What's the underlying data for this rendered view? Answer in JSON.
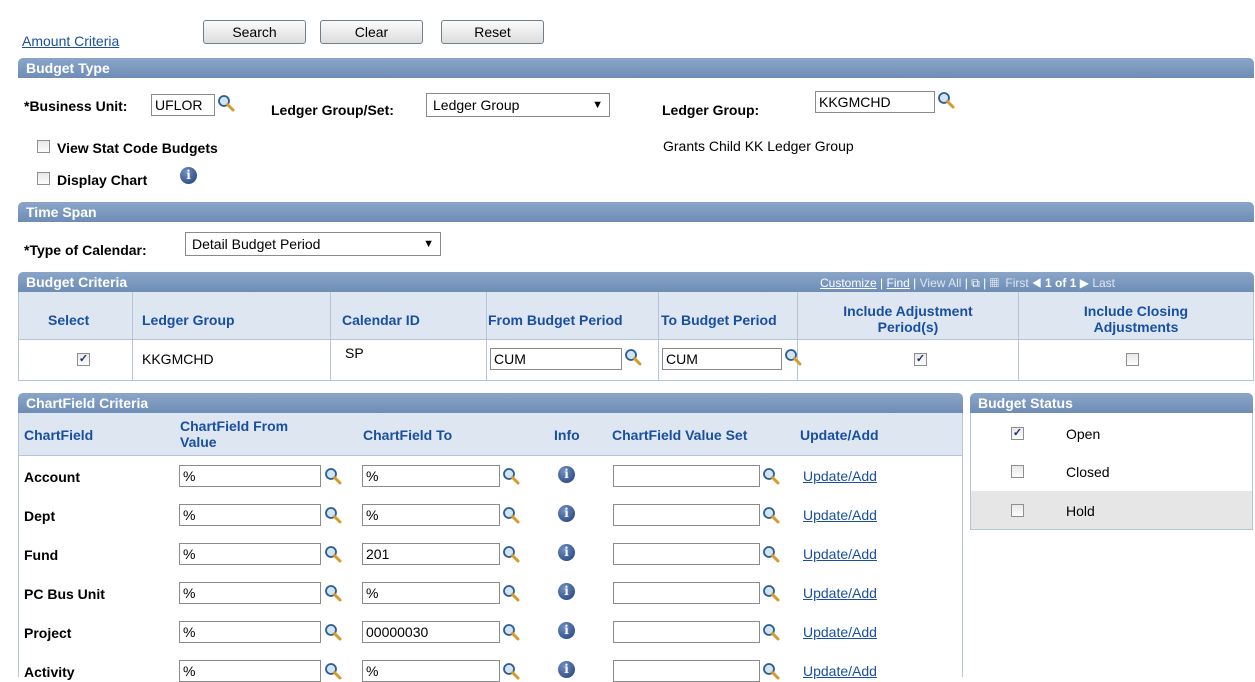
{
  "links": {
    "amount_criteria": "Amount Criteria"
  },
  "buttons": {
    "search": "Search",
    "clear": "Clear",
    "reset": "Reset"
  },
  "budget_type": {
    "header": "Budget Type",
    "business_unit_label": "*Business Unit:",
    "business_unit_value": "UFLOR",
    "ledger_group_set_label": "Ledger Group/Set:",
    "ledger_group_set_value": "Ledger Group",
    "ledger_group_label": "Ledger Group:",
    "ledger_group_value": "KKGMCHD",
    "ledger_group_desc": "Grants Child KK Ledger Group",
    "view_stat_code_label": "View Stat Code Budgets",
    "view_stat_code_checked": false,
    "display_chart_label": "Display Chart",
    "display_chart_checked": false
  },
  "time_span": {
    "header": "Time Span",
    "type_of_calendar_label": "*Type of Calendar:",
    "type_of_calendar_value": "Detail Budget Period"
  },
  "budget_criteria": {
    "header": "Budget Criteria",
    "nav": {
      "customize": "Customize",
      "find": "Find",
      "view_all": "View All",
      "first": "First",
      "count": "1 of 1",
      "last": "Last"
    },
    "columns": {
      "select": "Select",
      "ledger_group": "Ledger Group",
      "calendar_id": "Calendar ID",
      "from_period": "From Budget Period",
      "to_period": "To Budget Period",
      "incl_adj": "Include Adjustment Period(s)",
      "incl_closing": "Include Closing Adjustments"
    },
    "row": {
      "select": true,
      "ledger_group": "KKGMCHD",
      "calendar_id": "SP",
      "from_period": "CUM",
      "to_period": "CUM",
      "incl_adj": true,
      "incl_closing": false
    }
  },
  "chartfield_criteria": {
    "header": "ChartField Criteria",
    "columns": {
      "chartfield": "ChartField",
      "from_value": "ChartField From Value",
      "to": "ChartField To",
      "info": "Info",
      "value_set": "ChartField Value Set",
      "update_add": "Update/Add"
    },
    "rows": [
      {
        "name": "Account",
        "from": "%",
        "to": "%",
        "value_set": "",
        "link": "Update/Add"
      },
      {
        "name": "Dept",
        "from": "%",
        "to": "%",
        "value_set": "",
        "link": "Update/Add"
      },
      {
        "name": "Fund",
        "from": "%",
        "to": "201",
        "value_set": "",
        "link": "Update/Add"
      },
      {
        "name": "PC Bus Unit",
        "from": "%",
        "to": "%",
        "value_set": "",
        "link": "Update/Add"
      },
      {
        "name": "Project",
        "from": "%",
        "to": "00000030",
        "value_set": "",
        "link": "Update/Add"
      },
      {
        "name": "Activity",
        "from": "%",
        "to": "%",
        "value_set": "",
        "link": "Update/Add"
      }
    ]
  },
  "budget_status": {
    "header": "Budget Status",
    "items": [
      {
        "label": "Open",
        "checked": true
      },
      {
        "label": "Closed",
        "checked": false
      },
      {
        "label": "Hold",
        "checked": false
      }
    ]
  }
}
